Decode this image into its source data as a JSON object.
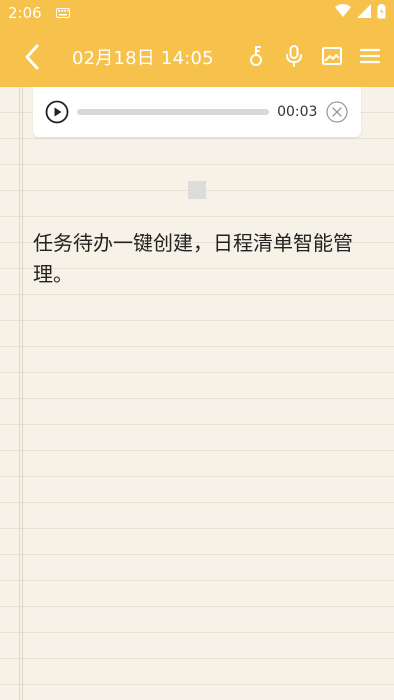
{
  "status_bar": {
    "time": "2:06",
    "icons": [
      "keyboard-icon",
      "wifi-icon",
      "cell-signal-icon",
      "battery-icon"
    ]
  },
  "app_bar": {
    "title": "02月18日 14:05",
    "actions": [
      "back-icon",
      "key-icon",
      "microphone-icon",
      "image-icon",
      "menu-icon"
    ],
    "color": "#f6c24c"
  },
  "audio_player": {
    "duration": "00:03",
    "progress": 0.0
  },
  "note": {
    "text": "任务待办一键创建，日程清单智能管理。"
  }
}
